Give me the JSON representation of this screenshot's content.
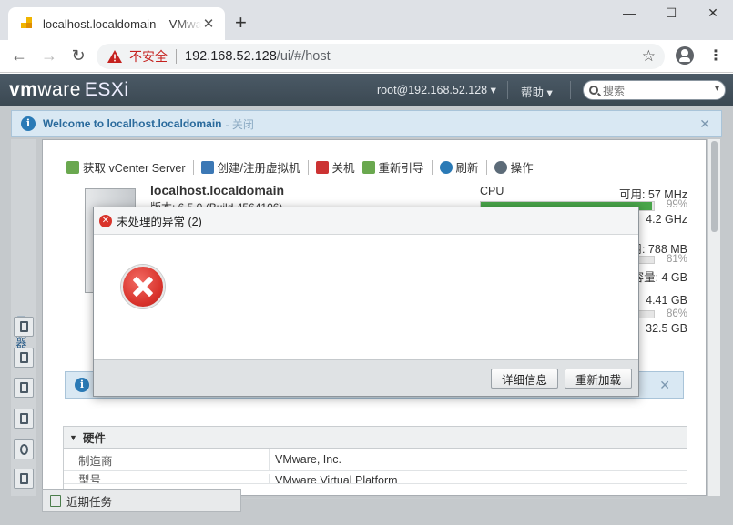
{
  "browser": {
    "tab_title": "localhost.localdomain – VMware ESXi",
    "tab_close": "✕",
    "new_tab": "+",
    "window_controls": {
      "minimize": "—",
      "maximize": "☐",
      "close": "✕"
    },
    "nav": {
      "back": "←",
      "forward": "→",
      "reload": "↻"
    },
    "security_label": "不安全",
    "url_host": "192.168.52.128",
    "url_path": "/ui/#/host",
    "bookmark_star": "☆",
    "menu": "⋮"
  },
  "esxi": {
    "logo_vm": "vm",
    "logo_ware": "ware",
    "logo_product": "ESXi",
    "user_menu": "root@192.168.52.128 ▾",
    "help_menu": "帮助 ▾",
    "search_placeholder": "搜索",
    "search_chevron": "▾",
    "welcome_text": "Welcome to localhost.localdomain",
    "welcome_close": "- 关闭",
    "close_x": "✕",
    "navigator_label": "导航器",
    "actions": [
      {
        "label": "获取 vCenter Server",
        "color": "#6aa84f"
      },
      {
        "label": "创建/注册虚拟机",
        "color": "#3c78b5"
      },
      {
        "label": "关机",
        "color": "#cc3333"
      },
      {
        "label": "重新引导",
        "color": "#6aa84f"
      },
      {
        "label": "刷新",
        "color": "#2a7ab6"
      },
      {
        "label": "操作",
        "color": "#5c6b78"
      }
    ],
    "host_name": "localhost.localdomain",
    "host_version_partial": "版本:        6.5.0 (Build 4564106)",
    "resources": {
      "cpu_label": "CPU",
      "cpu_free": "可用: 57 MHz",
      "cpu_pct": "99%",
      "cpu_fill": 0.99,
      "cpu_capacity": "4.2 GHz",
      "mem_free": "用: 788 MB",
      "mem_pct": "81%",
      "mem_capacity": "容量: 4 GB",
      "storage_free": "4.41 GB",
      "storage_pct": "86%",
      "storage_capacity": "32.5 GB"
    },
    "hardware": {
      "section_title": "硬件",
      "rows": [
        {
          "key": "制造商",
          "value": "VMware, Inc."
        },
        {
          "key": "型号",
          "value": "VMware Virtual Platform"
        }
      ]
    },
    "recent_tasks": "近期任务"
  },
  "dialog": {
    "title": "未处理的异常 (2)",
    "details_button": "详细信息",
    "reload_button": "重新加载"
  }
}
